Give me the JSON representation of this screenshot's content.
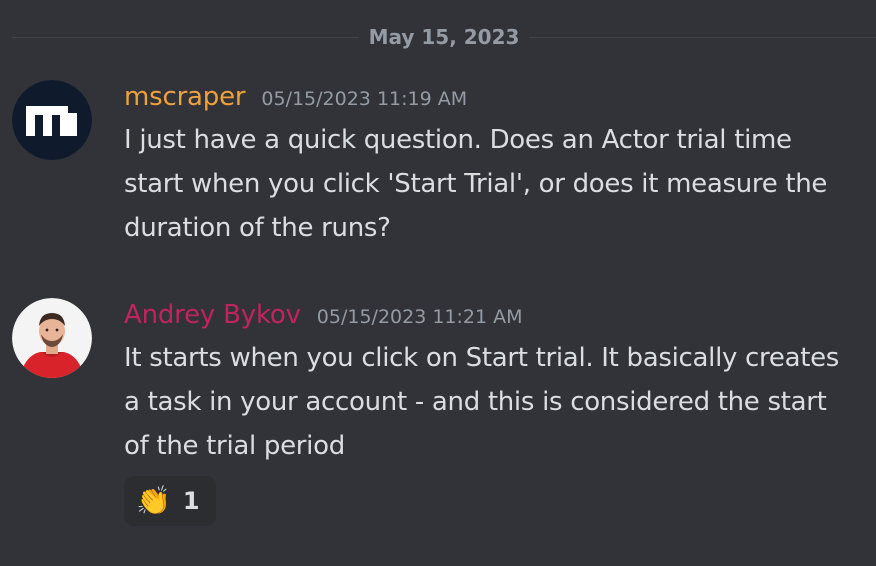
{
  "divider": {
    "date": "May 15, 2023"
  },
  "messages": [
    {
      "username": "mscraper",
      "username_color": "#f0a03c",
      "timestamp": "05/15/2023 11:19 AM",
      "text": "I just have a quick question. Does an Actor trial time start when you click 'Start Trial', or does it measure the duration of the runs?",
      "avatar_icon": "apify-logo-icon"
    },
    {
      "username": "Andrey Bykov",
      "username_color": "#c0245e",
      "timestamp": "05/15/2023 11:21 AM",
      "text": "It starts when you click on Start trial. It basically creates a task in your account - and this is considered the start of the trial period",
      "avatar_icon": "user-photo-avatar",
      "reaction": {
        "emoji": "👏",
        "emoji_icon": "clapping-hands-icon",
        "count": "1"
      }
    }
  ],
  "colors": {
    "background": "#313338",
    "text": "#dbdee1",
    "muted": "#949ba4"
  }
}
